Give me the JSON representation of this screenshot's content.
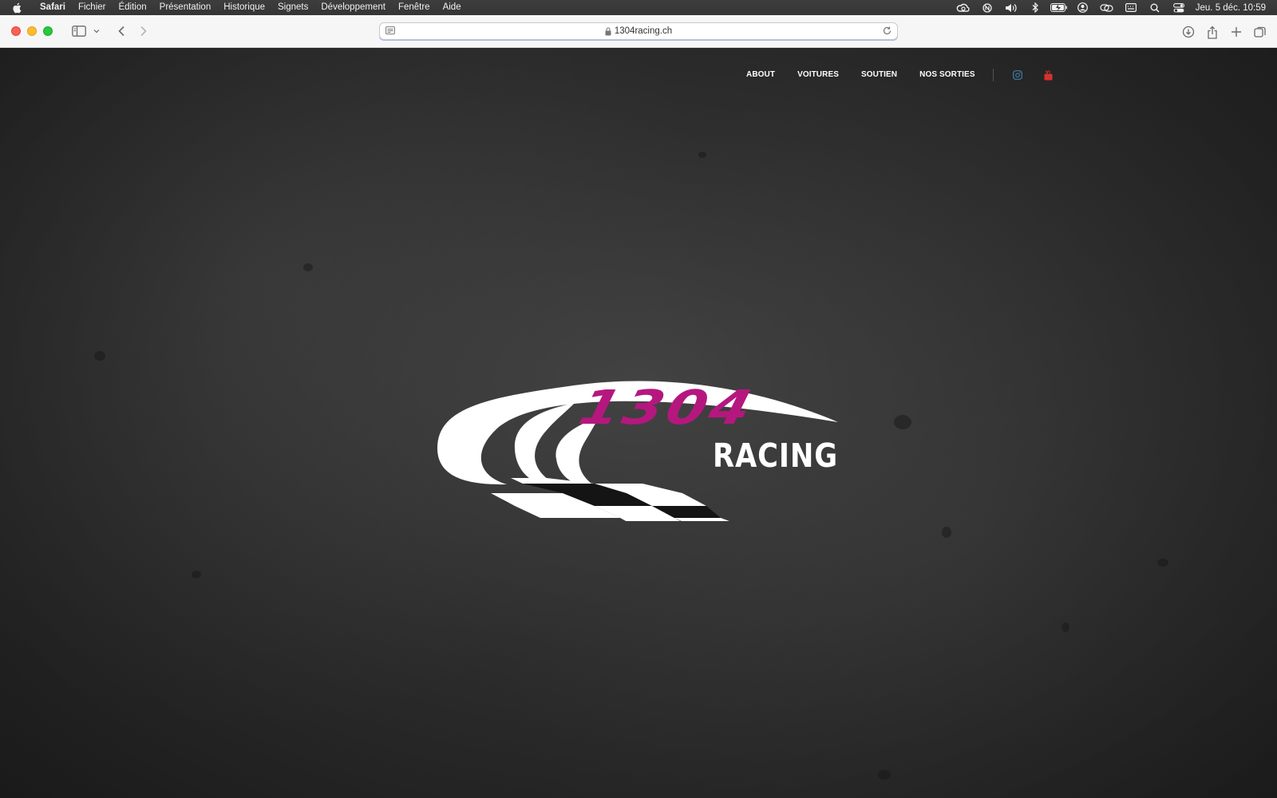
{
  "menubar": {
    "app_name": "Safari",
    "items": [
      "Fichier",
      "Édition",
      "Présentation",
      "Historique",
      "Signets",
      "Développement",
      "Fenêtre",
      "Aide"
    ],
    "clock": "Jeu. 5 déc.  10:59",
    "status_icons": [
      "creative-cloud-icon",
      "notchmeister-icon",
      "volume-icon",
      "bluetooth-icon",
      "battery-icon",
      "user-icon",
      "screen-mirroring-icon",
      "keyboard-icon",
      "spotlight-icon",
      "control-center-icon"
    ]
  },
  "browser": {
    "url": "1304racing.ch",
    "toolbar_icons": [
      "sidebar-icon",
      "chevron-down-icon",
      "back-icon",
      "forward-icon",
      "reader-icon",
      "lock-icon",
      "reload-icon",
      "download-icon",
      "share-icon",
      "new-tab-icon",
      "tab-overview-icon"
    ]
  },
  "site": {
    "nav": {
      "about": "ABOUT",
      "voitures": "VOITURES",
      "soutien": "SOUTIEN",
      "sorties": "NOS SORTIES"
    },
    "social": {
      "instagram_color": "#3e7fa8",
      "youtube_color": "#d6322e"
    },
    "logo": {
      "number": "1304",
      "word": "RACING",
      "number_color": "#b5177f",
      "word_color": "#ffffff"
    },
    "background_color": "#2e2e2e"
  }
}
